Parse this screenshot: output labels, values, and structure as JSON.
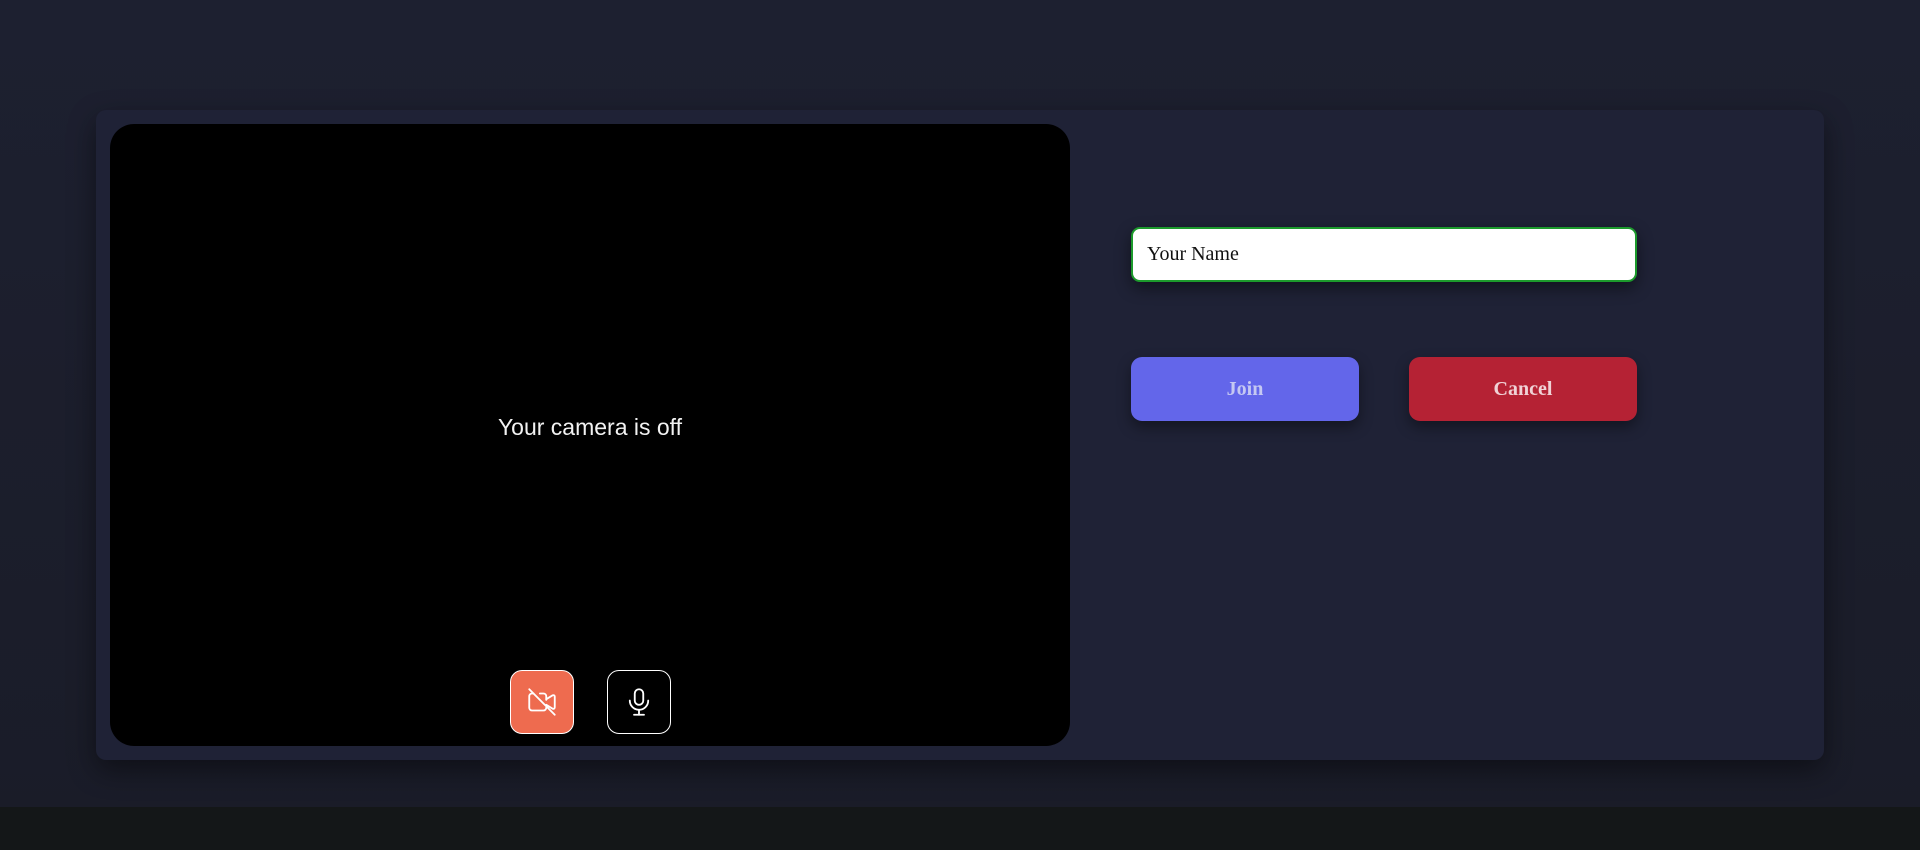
{
  "preview": {
    "camera_status_text": "Your camera is off",
    "camera_button_icon": "video-off-icon",
    "mic_button_icon": "microphone-icon"
  },
  "form": {
    "name_placeholder": "Your Name",
    "name_value": ""
  },
  "actions": {
    "join_label": "Join",
    "cancel_label": "Cancel"
  },
  "colors": {
    "camera_off_button": "#ee6b4f",
    "join_button": "#6366ea",
    "cancel_button": "#b52234",
    "input_focus_border": "#1c9a2c"
  }
}
